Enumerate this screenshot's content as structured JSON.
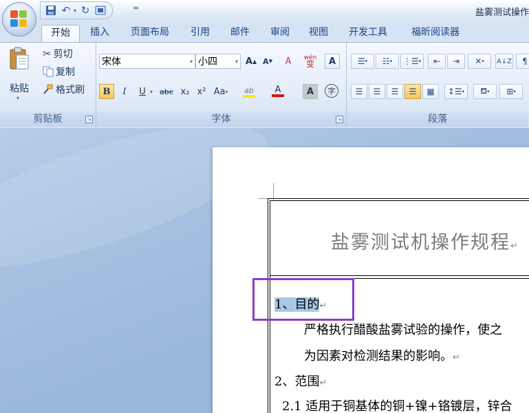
{
  "window": {
    "title": "盐雾测试操作"
  },
  "quick_access": {
    "items": [
      {
        "name": "save-icon",
        "glyph": "💾"
      },
      {
        "name": "undo-icon",
        "glyph": "↶"
      },
      {
        "name": "redo-icon",
        "glyph": "↻"
      },
      {
        "name": "print-preview-icon",
        "glyph": "▣"
      }
    ],
    "more": "="
  },
  "tabs": [
    "开始",
    "插入",
    "页面布局",
    "引用",
    "邮件",
    "审阅",
    "视图",
    "开发工具",
    "福昕阅读器"
  ],
  "ribbon": {
    "clipboard": {
      "label": "剪贴板",
      "paste": "粘贴",
      "cut": "剪切",
      "copy": "复制",
      "format_painter": "格式刷"
    },
    "font": {
      "label": "字体",
      "font_name": "宋体",
      "font_size": "小四",
      "grow": "A",
      "shrink": "A",
      "clear": "A",
      "phonetic": "wén",
      "border_char": "A",
      "bold": "B",
      "italic": "I",
      "underline": "U",
      "strike": "abc",
      "subscript": "x₂",
      "superscript": "x²",
      "case": "Aa",
      "highlight": "ab",
      "font_color": "A",
      "shading": "A",
      "enclose": "字"
    },
    "paragraph": {
      "label": "段落"
    }
  },
  "document": {
    "heading": "盐雾测试机操作规程",
    "section1_title": "1、目的",
    "section1_line1": "严格执行醋酸盐雾试验的操作，使之",
    "section1_line2": "为因素对检测结果的影响。",
    "section2_title": "2、范围",
    "section2_line1": "2.1 适用于铜基体的铜+镍+铬镀层，锌合",
    "para_mark": "↵"
  },
  "colors": {
    "annotation_box": "#8a3cc6",
    "selection": "#a9c8e6"
  }
}
